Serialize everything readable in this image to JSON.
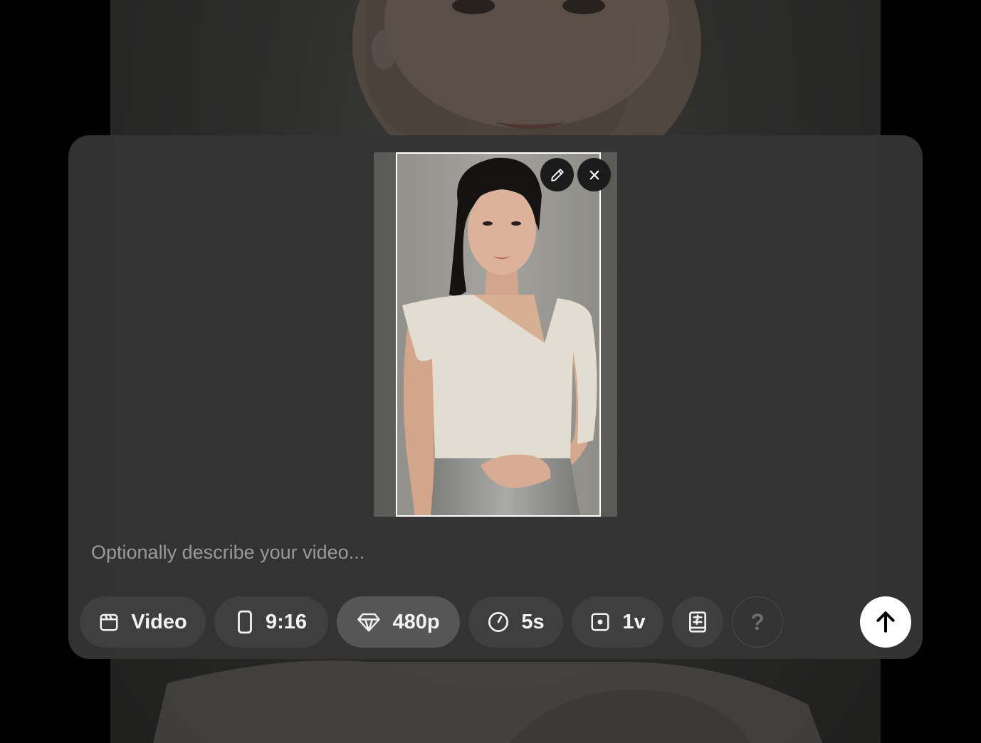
{
  "composer": {
    "prompt_placeholder": "Optionally describe your video...",
    "prompt_value": ""
  },
  "image_preview": {
    "edit_icon": "pencil-icon",
    "remove_icon": "close-icon"
  },
  "toolbar": {
    "mode": {
      "icon": "clapperboard-icon",
      "label": "Video"
    },
    "aspect_ratio": {
      "icon": "phone-portrait-icon",
      "label": "9:16"
    },
    "resolution": {
      "icon": "diamond-icon",
      "label": "480p"
    },
    "duration": {
      "icon": "timer-icon",
      "label": "5s"
    },
    "variations": {
      "icon": "square-dot-icon",
      "label": "1v"
    },
    "presets": {
      "icon": "book-sliders-icon"
    },
    "help": {
      "label": "?"
    },
    "submit": {
      "icon": "arrow-up-icon"
    }
  },
  "colors": {
    "panel_bg": "#343434",
    "chip_bg": "#3f3f3f",
    "chip_active_bg": "#565656",
    "submit_bg": "#ffffff",
    "text": "#f2f2f2",
    "placeholder": "#9a9a9a"
  }
}
